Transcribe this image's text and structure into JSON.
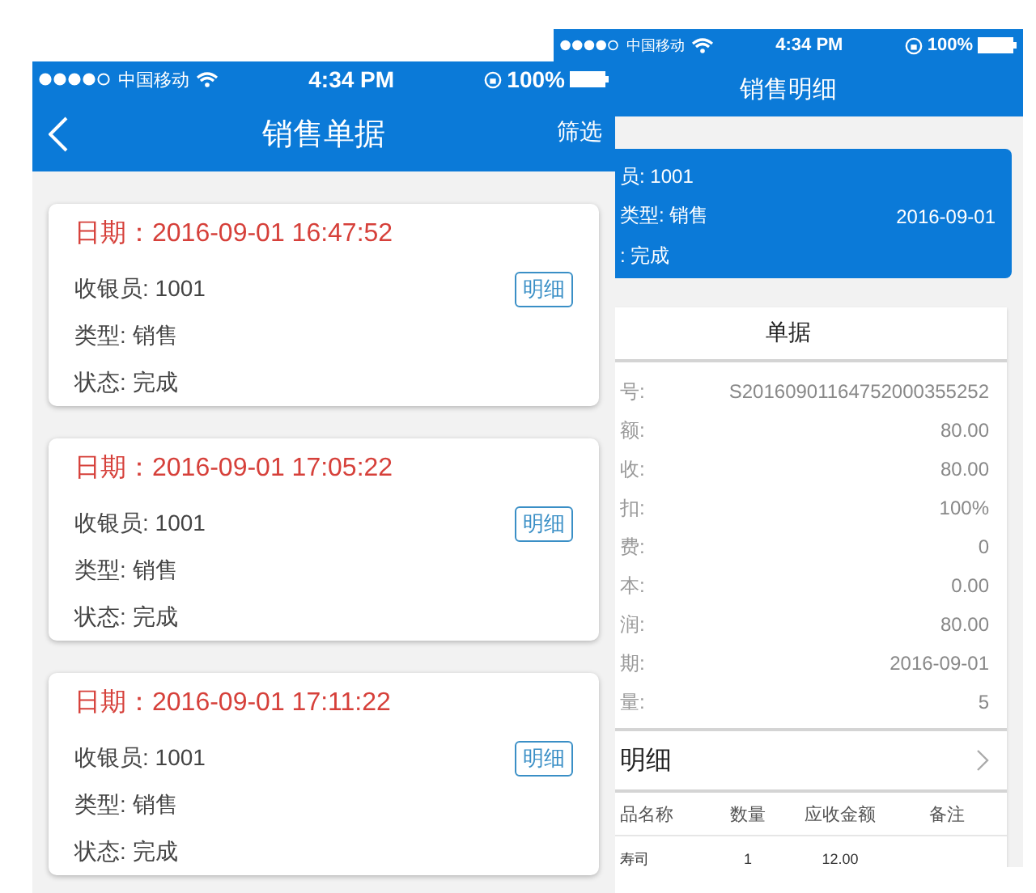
{
  "list_screen": {
    "status_bar": {
      "carrier": "中国移动",
      "time": "4:34 PM",
      "battery": "100%"
    },
    "title": "销售单据",
    "action": "筛选",
    "receipts": [
      {
        "date": "日期：2016-09-01 16:47:52",
        "cashier": "收银员: 1001",
        "detail_button": "明细",
        "type": "类型: 销售",
        "status": "状态: 完成"
      },
      {
        "date": "日期：2016-09-01 17:05:22",
        "cashier": "收银员: 1001",
        "detail_button": "明细",
        "type": "类型: 销售",
        "status": "状态: 完成"
      },
      {
        "date": "日期：2016-09-01 17:11:22",
        "cashier": "收银员: 1001",
        "detail_button": "明细",
        "type": "类型: 销售",
        "status": "状态: 完成"
      }
    ]
  },
  "detail_screen": {
    "status_bar": {
      "carrier": "中国移动",
      "time": "4:34 PM",
      "battery": "100%"
    },
    "title": "销售明细",
    "summary": {
      "cashier": "员: 1001",
      "type": "类型: 销售",
      "status": ": 完成",
      "date": "2016-09-01"
    },
    "receipt_card": {
      "title": "单据",
      "fields": [
        {
          "label": "号:",
          "value": "S20160901164752000355252"
        },
        {
          "label": "额:",
          "value": "80.00"
        },
        {
          "label": "收:",
          "value": "80.00"
        },
        {
          "label": "扣:",
          "value": "100%"
        },
        {
          "label": "费:",
          "value": "0"
        },
        {
          "label": "本:",
          "value": "0.00"
        },
        {
          "label": "润:",
          "value": "80.00"
        },
        {
          "label": "期:",
          "value": "2016-09-01"
        },
        {
          "label": "量:",
          "value": "5"
        }
      ]
    },
    "items_section": {
      "title": "明细",
      "columns": [
        "品名称",
        "数量",
        "应收金额",
        "备注"
      ],
      "rows": [
        {
          "product": "寿司",
          "quantity": "1",
          "amount": "12.00"
        }
      ]
    }
  }
}
